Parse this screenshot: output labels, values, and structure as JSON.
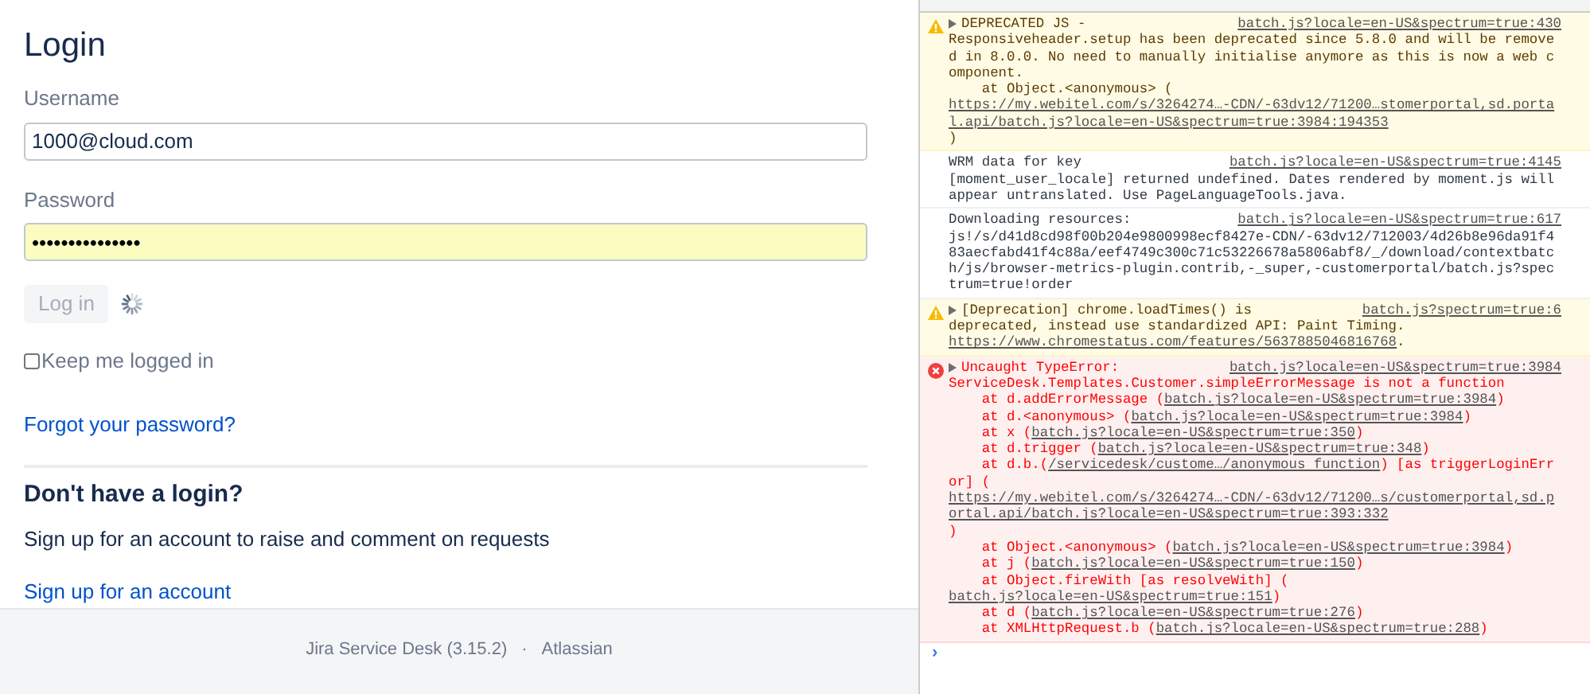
{
  "login": {
    "title": "Login",
    "username": {
      "label": "Username",
      "value": "1000@cloud.com"
    },
    "password": {
      "label": "Password",
      "value": "•••••••••••••••",
      "autofilled": true
    },
    "login_button": {
      "label": "Log in",
      "disabled": true,
      "loading": true
    },
    "remember": {
      "label": "Keep me logged in",
      "checked": false
    },
    "forgot_link": "Forgot your password?",
    "signup": {
      "heading": "Don't have a login?",
      "text": "Sign up for an account to raise and comment on requests",
      "link": "Sign up for an account"
    }
  },
  "footer": {
    "product": "Jira Service Desk (3.15.2)",
    "separator": "·",
    "company": "Atlassian"
  },
  "console": {
    "messages": [
      {
        "kind": "warning",
        "expandable": true,
        "head": "DEPRECATED JS -",
        "source": "batch.js?locale=en-US&spectrum=true:430",
        "parts": [
          {
            "kind": "plain",
            "text": "Responsiveheader.setup has been deprecated since 5.8.0 and will be removed in 8.0.0. No need to manually initialise anymore as this is now a web component."
          }
        ],
        "stack": [
          [
            {
              "kind": "plain",
              "text": "at Object.<anonymous> ("
            },
            {
              "kind": "link",
              "text": "https://my.webitel.com/s/3264274…-CDN/-63dv12/71200…stomerportal,sd.portal.api/batch.js?locale=en-US&spectrum=true:3984:194353"
            },
            {
              "kind": "plain",
              "text": ")"
            }
          ]
        ]
      },
      {
        "kind": "info",
        "expandable": false,
        "head": "WRM data for key",
        "source": "batch.js?locale=en-US&spectrum=true:4145",
        "parts": [
          {
            "kind": "plain",
            "text": "[moment_user_locale] returned undefined. Dates rendered by moment.js will appear untranslated. Use PageLanguageTools.java."
          }
        ]
      },
      {
        "kind": "info",
        "expandable": false,
        "head": "Downloading resources:",
        "source": "batch.js?locale=en-US&spectrum=true:617",
        "parts": [
          {
            "kind": "plain",
            "text": "js!/s/d41d8cd98f00b204e9800998ecf8427e-CDN/-63dv12/712003/4d26b8e96da91f483aecfabd41f4c88a/eef4749c300c71c53226678a5806abf8/_/download/contextbatch/js/browser-metrics-plugin.contrib,-_super,-customerportal/batch.js?spectrum=true!order"
          }
        ]
      },
      {
        "kind": "warning",
        "expandable": true,
        "head": "[Deprecation] chrome.loadTimes() is",
        "source": "batch.js?spectrum=true:6",
        "parts": [
          {
            "kind": "plain",
            "text": "deprecated, instead use standardized API: Paint Timing. "
          },
          {
            "kind": "link",
            "text": "https://www.chromestatus.com/features/5637885046816768"
          },
          {
            "kind": "plain",
            "text": "."
          }
        ]
      },
      {
        "kind": "error",
        "expandable": true,
        "head": "Uncaught TypeError:",
        "source": "batch.js?locale=en-US&spectrum=true:3984",
        "parts": [
          {
            "kind": "plain",
            "text": "ServiceDesk.Templates.Customer.simpleErrorMessage is not a function"
          }
        ],
        "stack": [
          [
            {
              "kind": "plain",
              "text": "at d.addErrorMessage ("
            },
            {
              "kind": "link",
              "text": "batch.js?locale=en-US&spectrum=true:3984"
            },
            {
              "kind": "plain",
              "text": ")"
            }
          ],
          [
            {
              "kind": "plain",
              "text": "at d.<anonymous> ("
            },
            {
              "kind": "link",
              "text": "batch.js?locale=en-US&spectrum=true:3984"
            },
            {
              "kind": "plain",
              "text": ")"
            }
          ],
          [
            {
              "kind": "plain",
              "text": "at x ("
            },
            {
              "kind": "link",
              "text": "batch.js?locale=en-US&spectrum=true:350"
            },
            {
              "kind": "plain",
              "text": ")"
            }
          ],
          [
            {
              "kind": "plain",
              "text": "at d.trigger ("
            },
            {
              "kind": "link",
              "text": "batch.js?locale=en-US&spectrum=true:348"
            },
            {
              "kind": "plain",
              "text": ")"
            }
          ],
          [
            {
              "kind": "plain",
              "text": "at d.b.("
            },
            {
              "kind": "link",
              "text": "/servicedesk/custome…/anonymous function"
            },
            {
              "kind": "plain",
              "text": ") [as triggerLoginError] ("
            },
            {
              "kind": "link",
              "text": "https://my.webitel.com/s/3264274…-CDN/-63dv12/71200…s/customerportal,sd.portal.api/batch.js?locale=en-US&spectrum=true:393:332"
            },
            {
              "kind": "plain",
              "text": ")"
            }
          ],
          [
            {
              "kind": "plain",
              "text": "at Object.<anonymous> ("
            },
            {
              "kind": "link",
              "text": "batch.js?locale=en-US&spectrum=true:3984"
            },
            {
              "kind": "plain",
              "text": ")"
            }
          ],
          [
            {
              "kind": "plain",
              "text": "at j ("
            },
            {
              "kind": "link",
              "text": "batch.js?locale=en-US&spectrum=true:150"
            },
            {
              "kind": "plain",
              "text": ")"
            }
          ],
          [
            {
              "kind": "plain",
              "text": "at Object.fireWith [as resolveWith] ("
            },
            {
              "kind": "link",
              "text": "batch.js?locale=en-US&spectrum=true:151"
            },
            {
              "kind": "plain",
              "text": ")"
            }
          ],
          [
            {
              "kind": "plain",
              "text": "at d ("
            },
            {
              "kind": "link",
              "text": "batch.js?locale=en-US&spectrum=true:276"
            },
            {
              "kind": "plain",
              "text": ")"
            }
          ],
          [
            {
              "kind": "plain",
              "text": "at XMLHttpRequest.b ("
            },
            {
              "kind": "link",
              "text": "batch.js?locale=en-US&spectrum=true:288"
            },
            {
              "kind": "plain",
              "text": ")"
            }
          ]
        ]
      }
    ],
    "prompt": "›"
  }
}
